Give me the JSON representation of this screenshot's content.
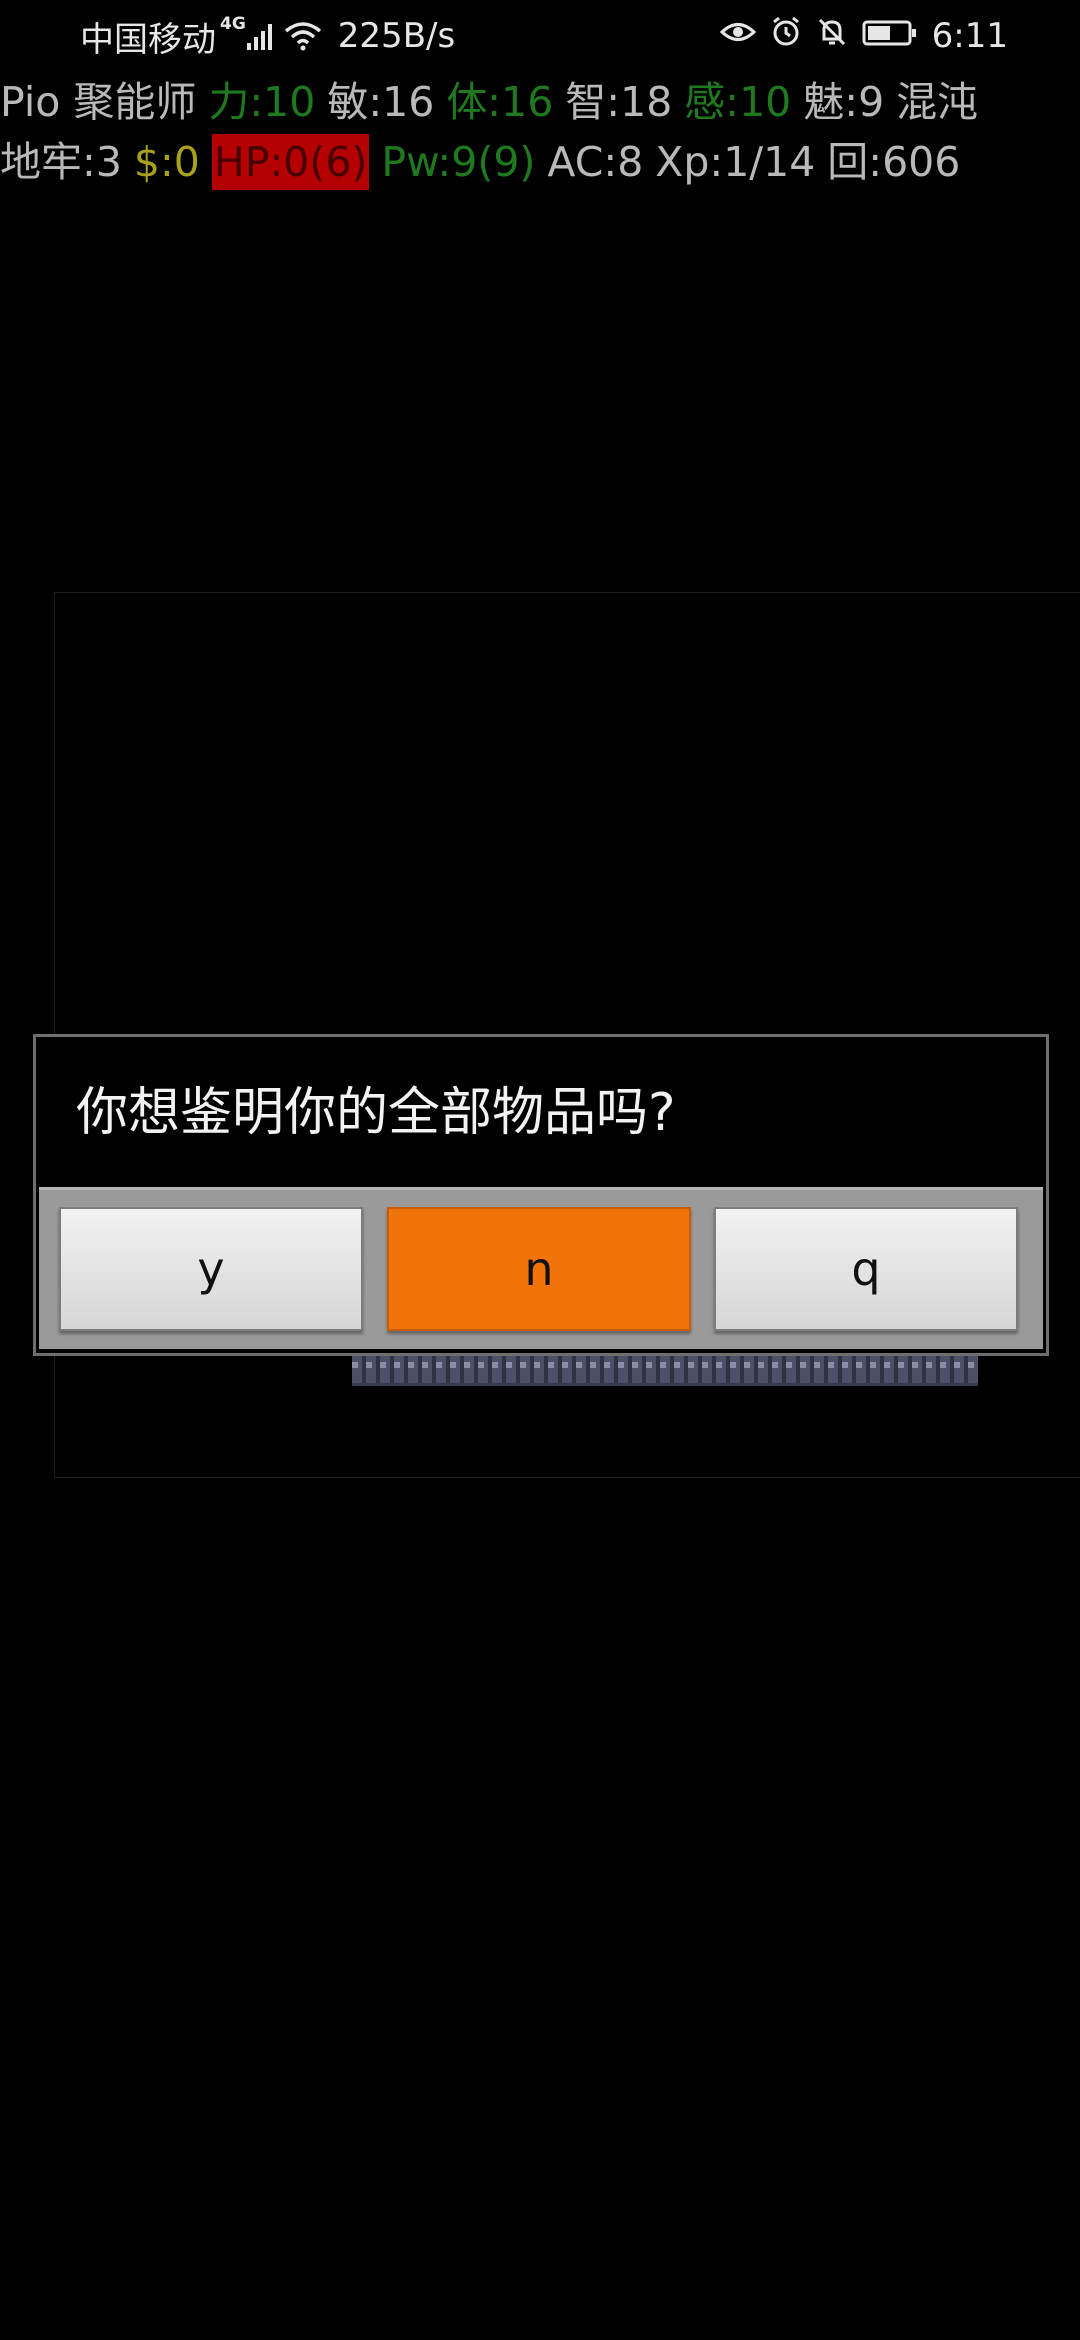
{
  "status_bar": {
    "carrier": "中国移动",
    "network_type": "4G",
    "net_speed": "225B/s",
    "time": "6:11",
    "icons": [
      "signal-icon",
      "wifi-icon",
      "eye-icon",
      "alarm-icon",
      "bell-off-icon",
      "battery-icon"
    ]
  },
  "game_status": {
    "line1": [
      {
        "text": "Pio 聚能师",
        "color": "gray"
      },
      {
        "text": "力:10",
        "color": "green"
      },
      {
        "text": "敏:16",
        "color": "gray"
      },
      {
        "text": "体:16",
        "color": "green"
      },
      {
        "text": "智:18",
        "color": "gray"
      },
      {
        "text": "感:10",
        "color": "green"
      },
      {
        "text": "魅:9",
        "color": "gray"
      },
      {
        "text": "混沌",
        "color": "gray"
      }
    ],
    "line2": [
      {
        "text": "地牢:3",
        "color": "gray"
      },
      {
        "text": "$:0",
        "color": "yellow"
      },
      {
        "text": "HP:0(6)",
        "color": "hp"
      },
      {
        "text": "Pw:9(9)",
        "color": "green"
      },
      {
        "text": "AC:8",
        "color": "gray"
      },
      {
        "text": "Xp:1/14",
        "color": "gray"
      },
      {
        "text": "回:606",
        "color": "gray"
      }
    ]
  },
  "dialog": {
    "question": "你想鉴明你的全部物品吗?",
    "buttons": [
      {
        "label": "y",
        "selected": false
      },
      {
        "label": "n",
        "selected": true
      },
      {
        "label": "q",
        "selected": false
      }
    ]
  },
  "colors": {
    "accent": "#f07409",
    "hp_background": "#b40000",
    "stat_green": "#1f7a1f",
    "gold_yellow": "#a8a11a"
  }
}
